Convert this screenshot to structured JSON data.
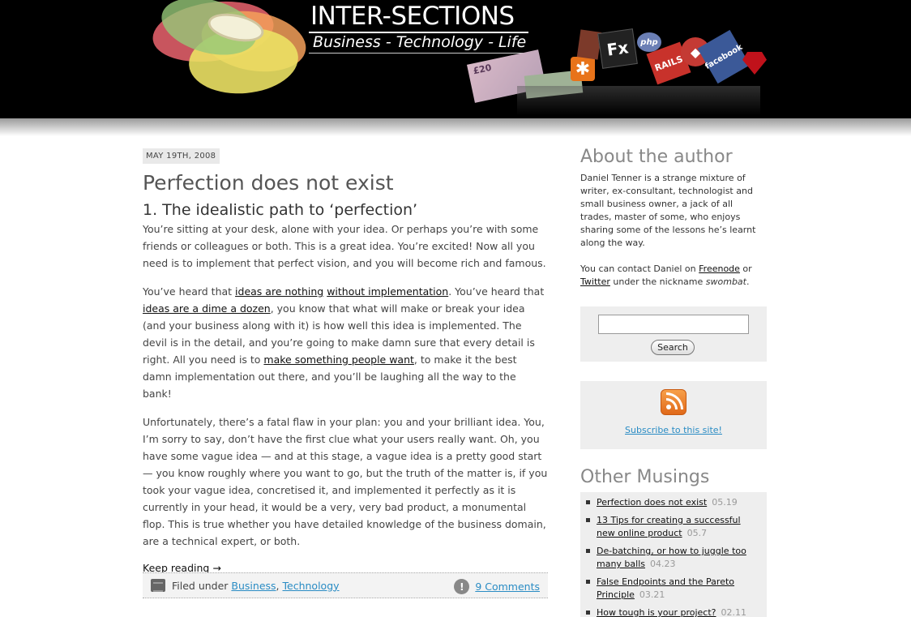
{
  "header": {
    "site_title": "INTER-SECTIONS",
    "tagline": "Business - Technology - Life",
    "collage": {
      "fx_label": "Fx",
      "php_label": "php",
      "rails_label": "RAILS",
      "facebook_label": "facebook",
      "banknote_label": "£20"
    }
  },
  "post": {
    "date": "MAY 19TH, 2008",
    "title": "Perfection does not exist",
    "subheading": "1. The idealistic path to ‘perfection’",
    "para1": "You’re sitting at your desk, alone with your idea. Or perhaps you’re with some friends or colleagues or both. This is a great idea. You’re excited! Now all you need is to implement that perfect vision, and you will become rich and famous.",
    "para2": {
      "t1": "You’ve heard that ",
      "link1": "ideas are nothing",
      "t2": " ",
      "link2": "without implementation",
      "t3": ". You’ve heard that ",
      "link3": "ideas are a dime a dozen",
      "t4": ", you know that what will make or break your idea (and your business along with it) is how well this idea is implemented. The devil is in the detail, and you’re going to make damn sure that every detail is right. All you need is to ",
      "link4": "make something people want",
      "t5": ", to make it the best damn implementation out there, and you’ll be laughing all the way to the bank!"
    },
    "para3": "Unfortunately, there’s a fatal flaw in your plan: you and your brilliant idea. You, I’m sorry to say, don’t have the first clue what your users really want. Oh, you have some vague idea — and at this stage, a vague idea is a pretty good start — you know roughly where you want to go, but the truth of the matter is, if you took your vague idea, concretised it, and implemented it perfectly as it is currently in your head, it would be a very, very bad product, a monumental flop. This is true whether you have detailed knowledge of the business domain, are a technical expert, or both.",
    "read_more": "Keep reading →",
    "meta": {
      "filed_under": "Filed under ",
      "category1": "Business",
      "separator": ", ",
      "category2": "Technology",
      "comments": "9 Comments"
    }
  },
  "sidebar": {
    "about_heading": "About the author",
    "about_text": "Daniel Tenner is a strange mixture of writer, ex-consultant, technologist and small business owner, a jack of all trades, master of some, who enjoys sharing some of the lessons he’s learnt along the way.",
    "contact": {
      "t1": "You can contact Daniel on ",
      "link1": "Freenode",
      "t2": " or ",
      "link2": "Twitter",
      "t3": " under the nickname ",
      "nickname": "swombat",
      "t4": "."
    },
    "search": {
      "value": "",
      "button_label": "Search"
    },
    "subscribe_label": "Subscribe to this site!",
    "musings_heading": "Other Musings",
    "musings": [
      {
        "title": "Perfection does not exist",
        "date": "05.19"
      },
      {
        "title": "13 Tips for creating a successful new online product",
        "date": "05.7"
      },
      {
        "title": "De-batching, or how to juggle too many balls",
        "date": "04.23"
      },
      {
        "title": "False Endpoints and the Pareto Principle",
        "date": "03.21"
      },
      {
        "title": "How tough is your project?",
        "date": "02.11"
      }
    ]
  }
}
